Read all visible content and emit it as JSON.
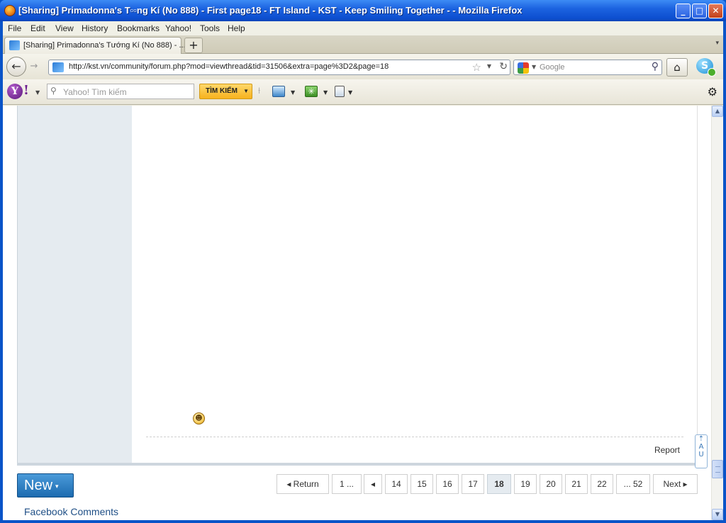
{
  "window": {
    "title": "[Sharing] Primadonna's T▫▫ng Kí (No 888) - First page18 - FT Island - KST - Keep Smiling Together - - Mozilla Firefox",
    "minimize": "_",
    "maximize": "□",
    "close": "✕"
  },
  "menu": [
    "File",
    "Edit",
    "View",
    "History",
    "Bookmarks",
    "Yahoo!",
    "Tools",
    "Help"
  ],
  "tab": {
    "label": "[Sharing] Primadonna's Tướng Kí (No 888) - ...",
    "new_tab": "+",
    "list_arrow": "▾"
  },
  "nav": {
    "back": "←",
    "forward": "→",
    "url": "http://kst.vn/community/forum.php?mod=viewthread&tid=31506&extra=page%3D2&page=18",
    "star": "☆",
    "drop": "▼",
    "reload": "↻",
    "search_placeholder": "Google",
    "search_drop": "▼",
    "search_icon": "⚲",
    "home": "⌂",
    "skype": "S"
  },
  "yahoo": {
    "logo": "Y",
    "bang": "!",
    "search_placeholder": "Yahoo! Tìm kiếm",
    "search_button": "TÌM KIẾM",
    "separator": "⟊",
    "gear": "⚙"
  },
  "post": {
    "report": "Report",
    "smiley": "☻"
  },
  "toolbar": {
    "new_label": "New",
    "new_arrow": "▾"
  },
  "pagination": {
    "return": "◂ Return",
    "first": "1 ...",
    "prev": "◂",
    "pages": [
      "14",
      "15",
      "16",
      "17",
      "18",
      "19",
      "20",
      "21",
      "22"
    ],
    "current": "18",
    "last": "... 52",
    "next": "Next ▸"
  },
  "facebook": {
    "label": "Facebook Comments"
  },
  "scroll": {
    "up": "▲",
    "down": "▼"
  },
  "side_widget": {
    "text": "⇡ A U"
  }
}
